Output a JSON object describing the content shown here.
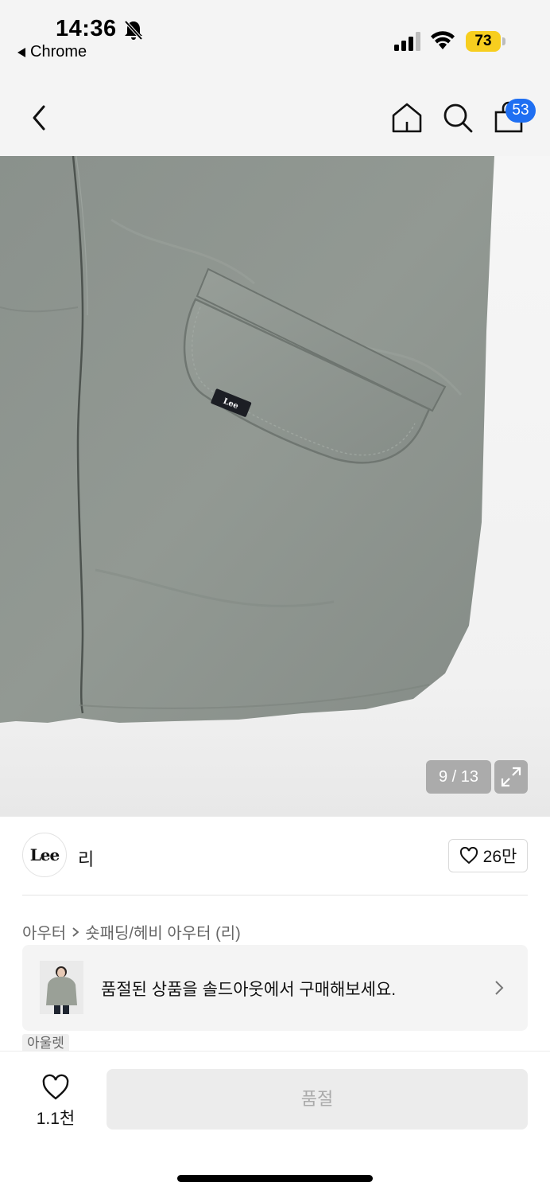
{
  "status_bar": {
    "time": "14:36",
    "back_app": "Chrome",
    "battery": "73",
    "icons": [
      "bell-slash-icon",
      "signal-icon",
      "wifi-icon",
      "battery-icon"
    ]
  },
  "header": {
    "icons": [
      "chevron-left-icon",
      "home-icon",
      "search-icon",
      "shopping-bag-icon"
    ],
    "cart_count": "53"
  },
  "gallery": {
    "counter": "9 / 13",
    "garment_color": "#8e958f",
    "label_text": "Lee"
  },
  "brand": {
    "logo_text": "Lee",
    "name": "리",
    "likes": "26만"
  },
  "breadcrumb": {
    "items": [
      "아우터",
      "숏패딩/헤비 아우터 (리)"
    ]
  },
  "soldout_banner": {
    "text": "품절된 상품을 솔드아웃에서 구매해보세요."
  },
  "outlet_tag": "아울렛",
  "bottom": {
    "wish_count": "1.1천",
    "buy_button": "품절"
  },
  "colors": {
    "accent": "#1f6ff2",
    "battery": "#f7ce1f"
  }
}
